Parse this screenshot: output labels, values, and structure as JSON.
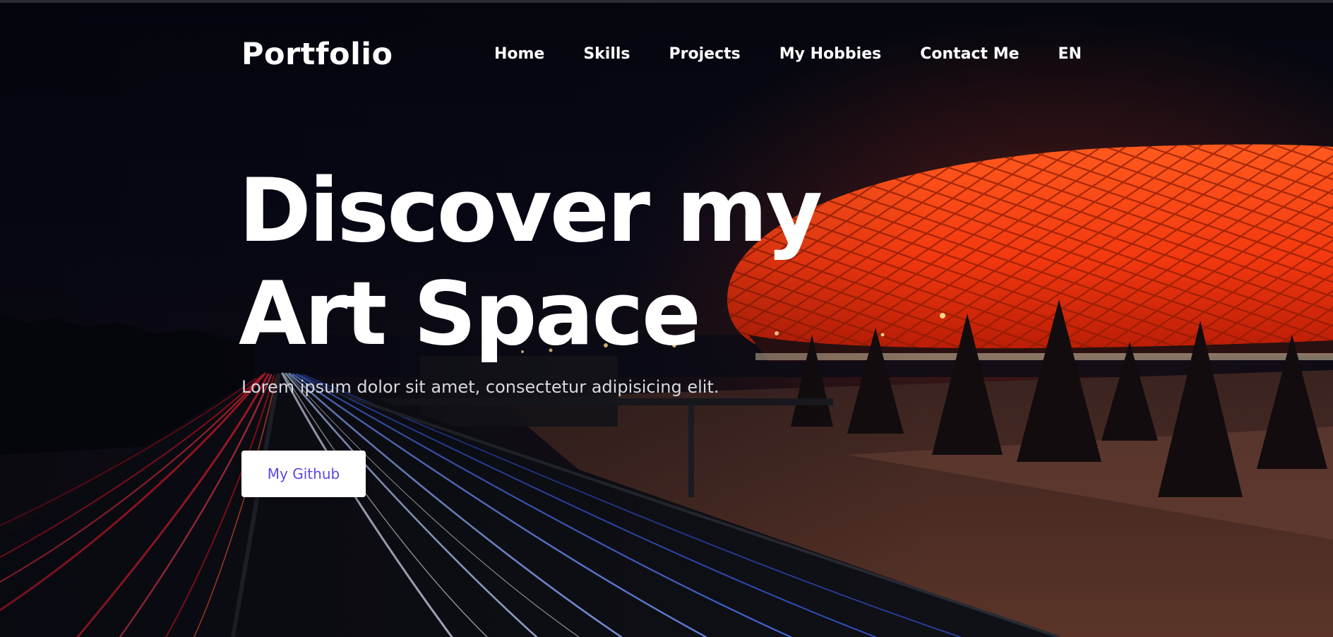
{
  "nav": {
    "brand": "Portfolio",
    "items": [
      {
        "label": "Home"
      },
      {
        "label": "Skills"
      },
      {
        "label": "Projects"
      },
      {
        "label": "My Hobbies"
      },
      {
        "label": "Contact Me"
      },
      {
        "label": "EN"
      }
    ]
  },
  "hero": {
    "title_line1": "Discover my",
    "title_line2": "Art Space",
    "subtitle": "Lorem ipsum dolor sit amet, consectetur adipisicing elit.",
    "button_label": "My Github"
  },
  "colors": {
    "text": "#ffffff",
    "button_text": "#5a48e6",
    "stadium_glow": "#ff3a12",
    "background": "#05070f"
  }
}
